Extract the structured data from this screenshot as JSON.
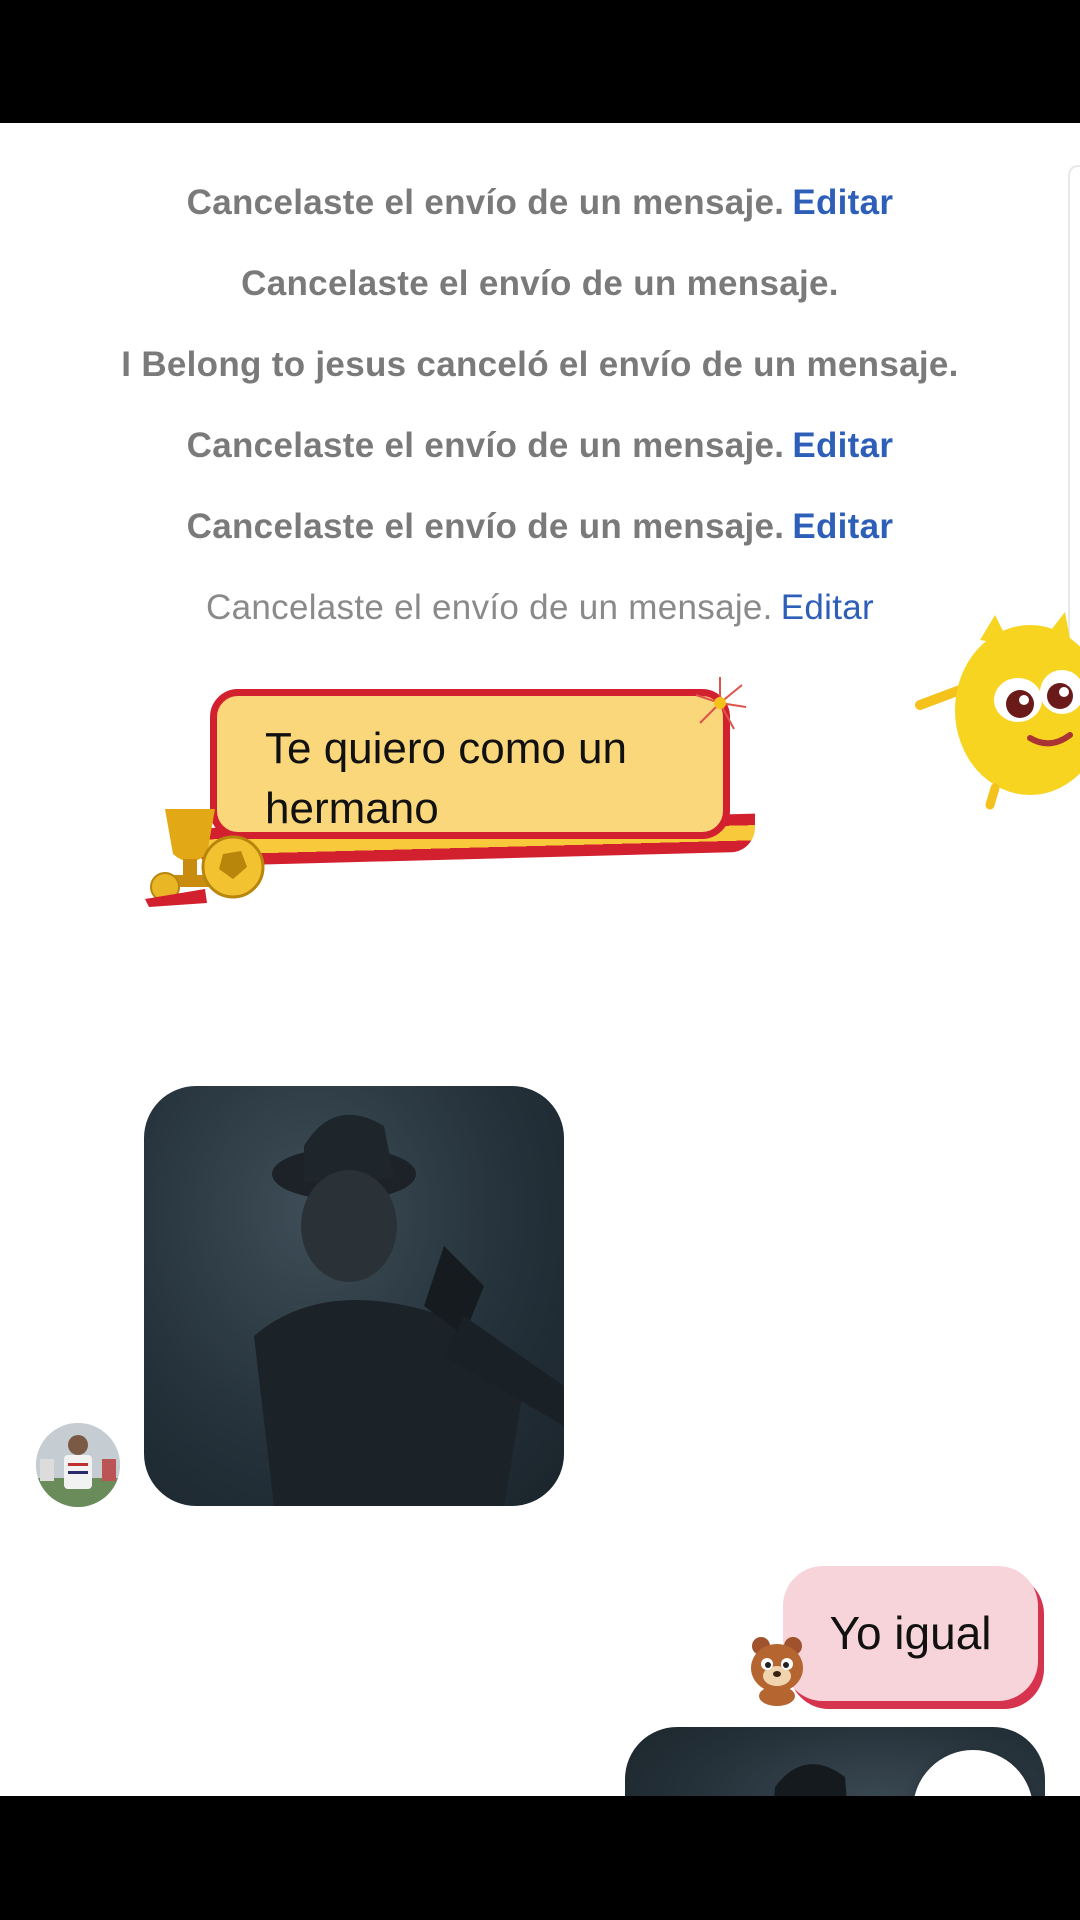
{
  "system_messages": [
    {
      "text": "Cancelaste el envío de un mensaje.",
      "edit_label": "Editar"
    },
    {
      "text": "Cancelaste el envío de un mensaje.",
      "edit_label": ""
    },
    {
      "text": "I Belong to jesus canceló el envío de un mensaje.",
      "edit_label": ""
    },
    {
      "text": "Cancelaste el envío de un mensaje.",
      "edit_label": "Editar"
    },
    {
      "text": "Cancelaste el envío de un mensaje.",
      "edit_label": "Editar"
    },
    {
      "text": "Cancelaste el envío de un mensaje.",
      "edit_label": "Editar"
    }
  ],
  "received": {
    "sticker_text": "Te quiero como un hermano",
    "media_icon": "video-thumbnail",
    "avatar_icon": "contact-avatar"
  },
  "sent": {
    "text": "Yo igual",
    "media_icon": "video-thumbnail"
  },
  "controls": {
    "scroll_down_icon": "chevron-down-icon"
  },
  "colors": {
    "edit_link": "#2d5fb8",
    "system_text": "#7a7a7a",
    "sticker_fill": "#f9d77a",
    "sticker_border": "#d3202f",
    "sent_bubble": "#f7d4da"
  }
}
